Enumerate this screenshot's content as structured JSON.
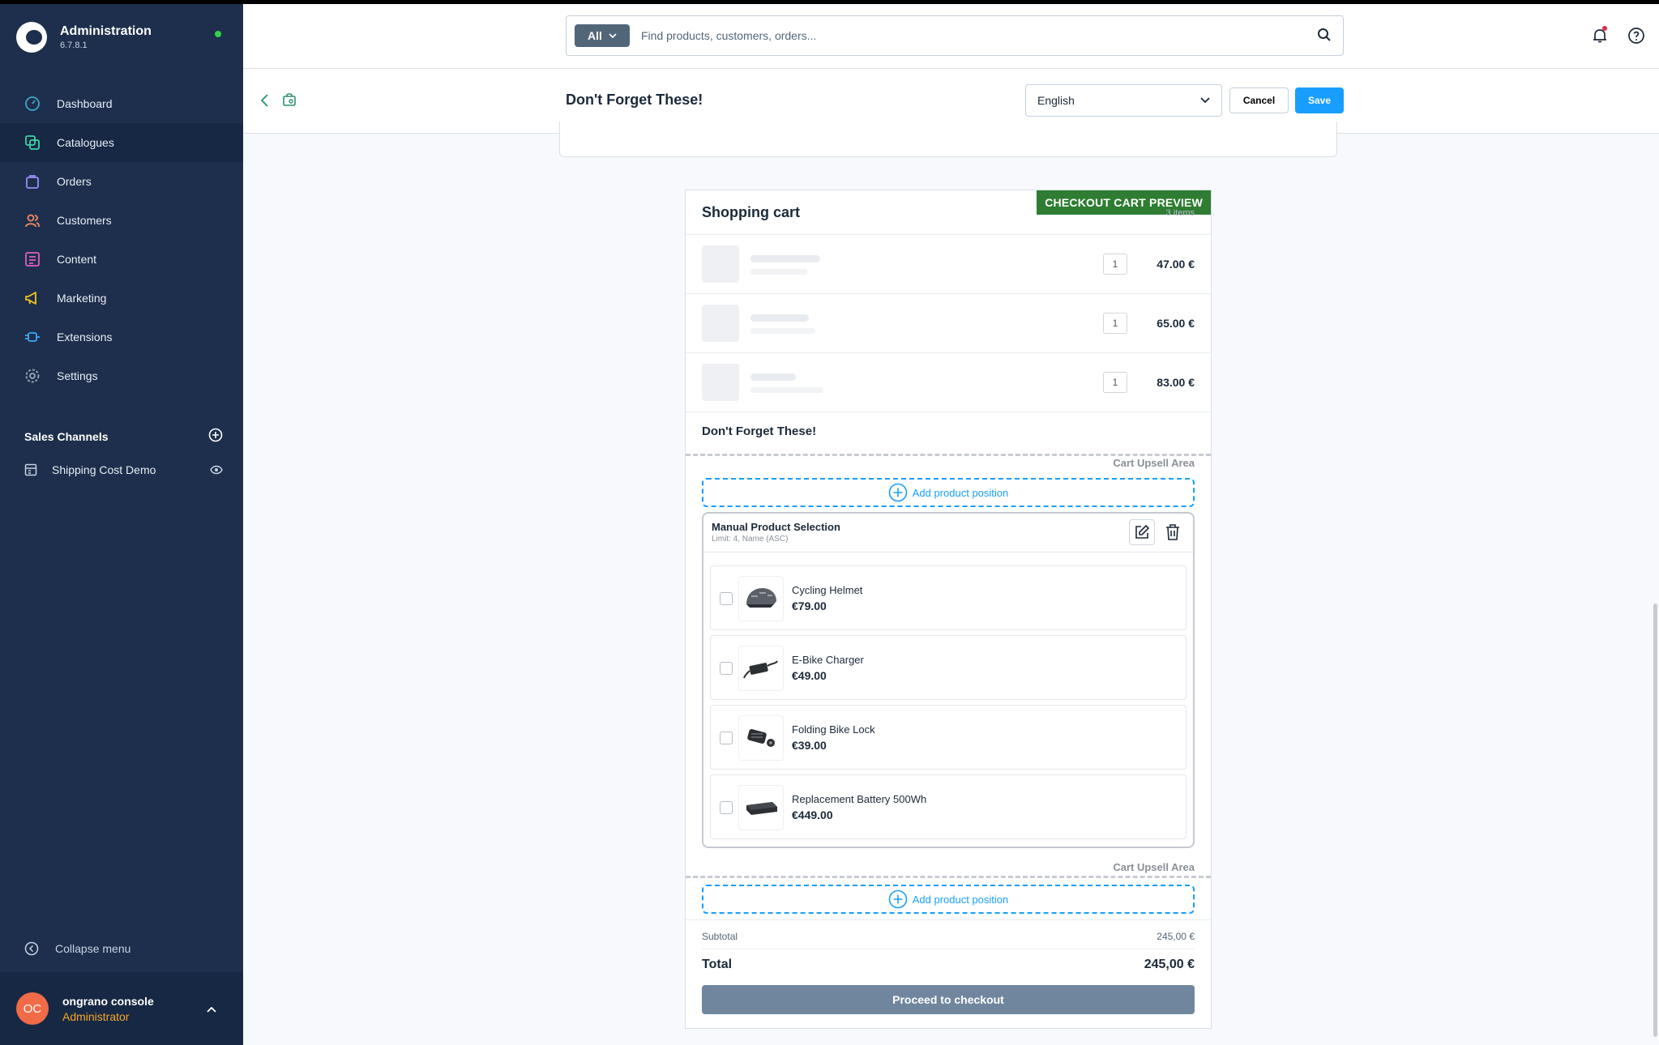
{
  "app": {
    "title": "Administration",
    "version": "6.7.8.1"
  },
  "nav": {
    "items": [
      {
        "label": "Dashboard",
        "icon": "dashboard-icon"
      },
      {
        "label": "Catalogues",
        "icon": "catalogue-icon",
        "active": true
      },
      {
        "label": "Orders",
        "icon": "orders-icon"
      },
      {
        "label": "Customers",
        "icon": "customers-icon"
      },
      {
        "label": "Content",
        "icon": "content-icon"
      },
      {
        "label": "Marketing",
        "icon": "marketing-icon"
      },
      {
        "label": "Extensions",
        "icon": "extensions-icon"
      },
      {
        "label": "Settings",
        "icon": "settings-icon"
      }
    ],
    "sales_channels_label": "Sales Channels",
    "sales_channel": "Shipping Cost Demo",
    "collapse_label": "Collapse menu"
  },
  "user": {
    "initials": "OC",
    "name": "ongrano console",
    "role": "Administrator"
  },
  "header": {
    "search_scope": "All",
    "search_placeholder": "Find products, customers, orders..."
  },
  "smartbar": {
    "title": "Don't Forget These!",
    "language": "English",
    "cancel_label": "Cancel",
    "save_label": "Save"
  },
  "cart": {
    "title": "Shopping cart",
    "items_hint": "3 items",
    "preview_badge": "CHECKOUT CART PREVIEW",
    "rows": [
      {
        "qty": "1",
        "price": "47.00 €"
      },
      {
        "qty": "1",
        "price": "65.00 €"
      },
      {
        "qty": "1",
        "price": "83.00 €"
      }
    ],
    "section_title": "Don't Forget These!",
    "upsell_area_label": "Cart Upsell Area",
    "add_position_label": "Add product position",
    "manual_selection": {
      "title": "Manual Product Selection",
      "subtitle": "Limit: 4, Name (ASC)",
      "products": [
        {
          "name": "Cycling Helmet",
          "price": "€79.00",
          "icon": "helmet-image"
        },
        {
          "name": "E-Bike Charger",
          "price": "€49.00",
          "icon": "charger-image"
        },
        {
          "name": "Folding Bike Lock",
          "price": "€39.00",
          "icon": "lock-image"
        },
        {
          "name": "Replacement Battery 500Wh",
          "price": "€449.00",
          "icon": "battery-image"
        }
      ]
    },
    "subtotal_label": "Subtotal",
    "subtotal_value": "245,00 €",
    "total_label": "Total",
    "total_value": "245,00 €",
    "checkout_label": "Proceed to checkout"
  },
  "colors": {
    "sidebar_bg": "#1d2f4c",
    "accent": "#189eff",
    "preview_badge": "#2e7d32",
    "role_text": "#f7a823",
    "avatar": "#f06b46"
  }
}
